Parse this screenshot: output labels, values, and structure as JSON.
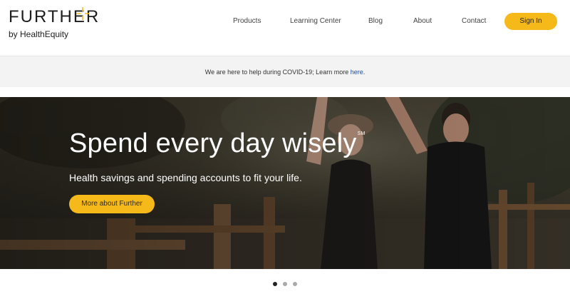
{
  "brand": {
    "name": "FURTHER",
    "sub": "by HealthEquity",
    "accent": "#f6b91a"
  },
  "nav": {
    "items": [
      {
        "label": "Products"
      },
      {
        "label": "Learning Center"
      },
      {
        "label": "Blog"
      },
      {
        "label": "About"
      },
      {
        "label": "Contact"
      }
    ],
    "signin_label": "Sign In"
  },
  "notice": {
    "text": "We are here to help during COVID-19; Learn more ",
    "link_label": "here",
    "trail": "."
  },
  "hero": {
    "title": "Spend every day wisely",
    "title_mark": "SM",
    "subtitle": "Health savings and spending accounts to fit your life.",
    "cta_label": "More about Further"
  },
  "carousel": {
    "slides": 3,
    "active": 1
  },
  "icons": {
    "logo_mark": "sparkle-icon"
  }
}
